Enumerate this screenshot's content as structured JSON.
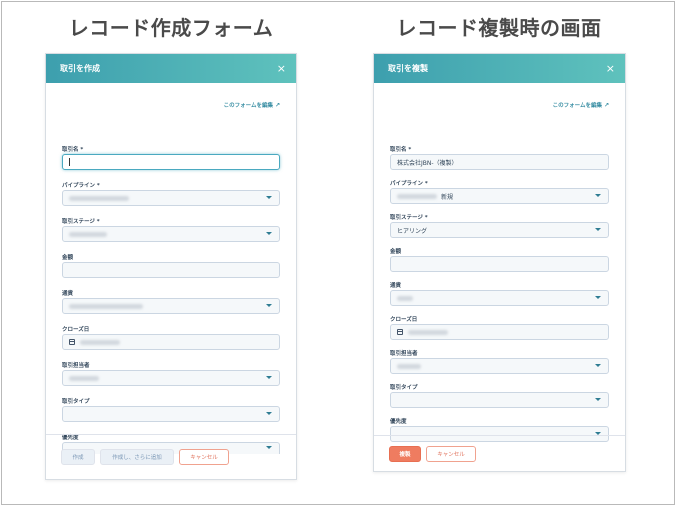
{
  "captions": {
    "left": "レコード作成フォーム",
    "right": "レコード複製時の画面"
  },
  "colors": {
    "header_start": "#3d9fae",
    "header_end": "#5fc2bd",
    "primary": "#ef7c60",
    "link": "#3a8fa4"
  },
  "create_form": {
    "title": "取引を作成",
    "close": "×",
    "edit_link": "このフォームを編集",
    "fields": {
      "deal_name": "取引名 *",
      "pipeline": "パイプライン *",
      "deal_stage": "取引ステージ *",
      "amount": "金額",
      "currency": "通貨",
      "close_date": "クローズ日",
      "owner": "取引担当者",
      "deal_type": "取引タイプ",
      "priority": "優先度"
    },
    "buttons": {
      "create": "作成",
      "create_add": "作成し、さらに追加",
      "cancel": "キャンセル"
    }
  },
  "clone_form": {
    "title": "取引を複製",
    "close": "×",
    "edit_link": "このフォームを編集",
    "fields": {
      "deal_name": "取引名 *",
      "deal_name_value": "株式会社JBN-（複製）",
      "pipeline": "パイプライン *",
      "pipeline_value": "新規",
      "deal_stage": "取引ステージ *",
      "deal_stage_value": "ヒアリング",
      "amount": "金額",
      "currency": "通貨",
      "close_date": "クローズ日",
      "owner": "取引担当者",
      "deal_type": "取引タイプ",
      "priority": "優先度"
    },
    "buttons": {
      "clone": "複製",
      "cancel": "キャンセル"
    }
  }
}
